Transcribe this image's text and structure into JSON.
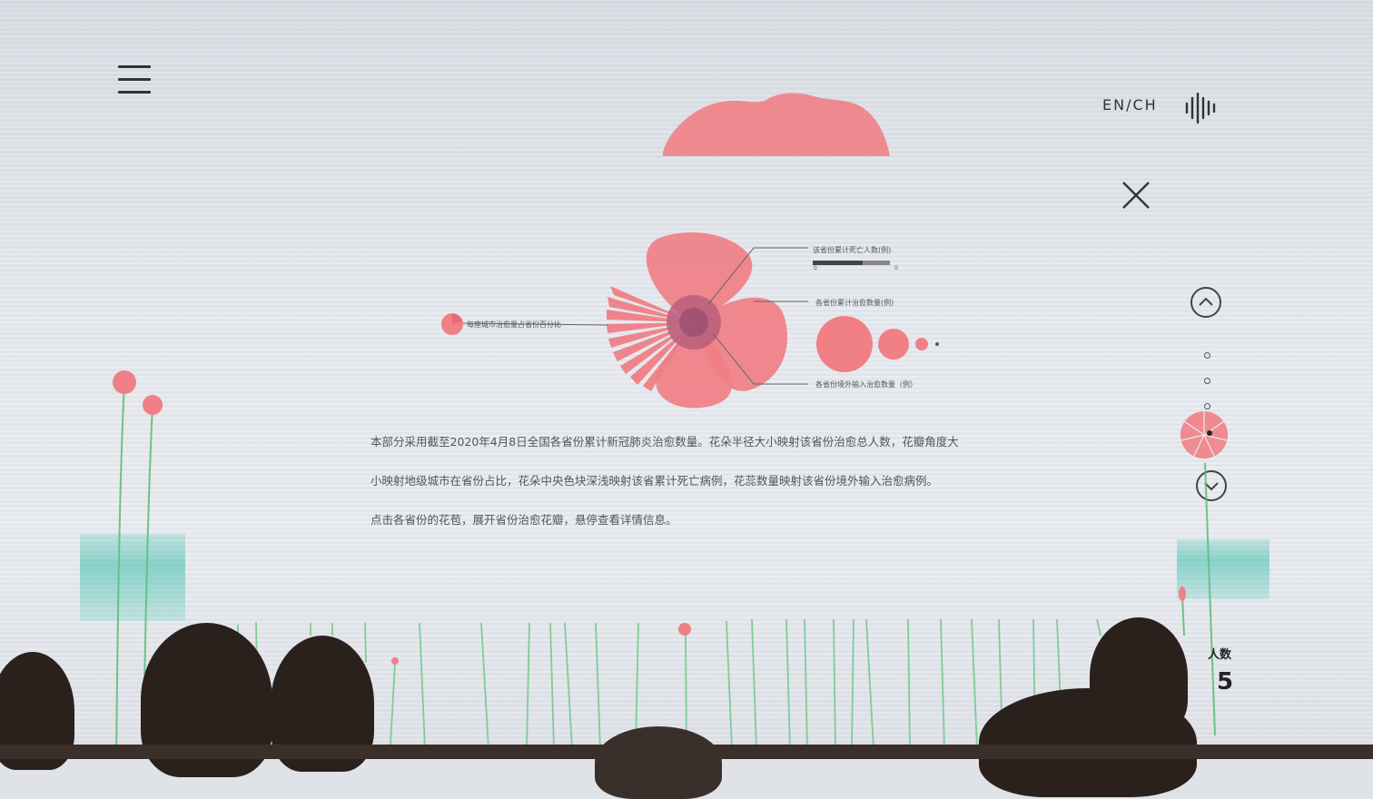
{
  "header": {
    "lang_toggle": "EN/CH"
  },
  "legend": {
    "label_death": "该省份累计死亡人数(例)",
    "label_death_scale_min": "0",
    "label_death_scale_max": "0",
    "label_cured": "各省份累计治愈数量(例)",
    "label_imported": "各省份境外输入治愈数量（例）",
    "label_city": "每座城市治愈量占省份百分比"
  },
  "description": {
    "line1": "本部分采用截至2020年4月8日全国各省份累计新冠肺炎治愈数量。花朵半径大小映射该省份治愈总人数，花瓣角度大",
    "line2": "小映射地级城市在省份占比，花朵中央色块深浅映射该省累计死亡病例，花蕊数量映射该省份境外输入治愈病例。",
    "line3": "点击各省份的花苞，展开省份治愈花瓣，悬停查看详情信息。"
  },
  "side_panel": {
    "label": "人数",
    "value": "5"
  },
  "colors": {
    "petal": "#f07f86",
    "petal_dark": "#b85e7b",
    "stem": "#5fbf7d",
    "teal": "#4fc6b4"
  }
}
